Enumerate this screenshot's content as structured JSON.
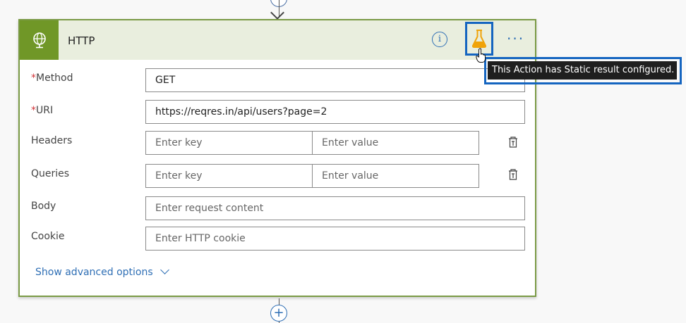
{
  "card": {
    "title": "HTTP",
    "icon": "globe-icon",
    "accent_color": "#709727",
    "header_bg": "#e9eede"
  },
  "fields": {
    "method": {
      "label": "Method",
      "required_mark": "*",
      "value": "GET"
    },
    "uri": {
      "label": "URI",
      "required_mark": "*",
      "value": "https://reqres.in/api/users?page=2"
    },
    "headers": {
      "label": "Headers",
      "key_placeholder": "Enter key",
      "value_placeholder": "Enter value"
    },
    "queries": {
      "label": "Queries",
      "key_placeholder": "Enter key",
      "value_placeholder": "Enter value"
    },
    "body": {
      "label": "Body",
      "placeholder": "Enter request content"
    },
    "cookie": {
      "label": "Cookie",
      "placeholder": "Enter HTTP cookie"
    }
  },
  "advanced_link": "Show advanced options",
  "tooltip": "This Action has Static result configured.",
  "icons": {
    "info": "info-icon",
    "static_result": "flask-icon",
    "more": "more-options-icon",
    "delete": "delete-row-icon",
    "add": "add-step-icon"
  },
  "colors": {
    "link": "#2f6fb5",
    "highlight_border": "#1565c0",
    "flask": "#f0a30a",
    "required": "#d13438"
  }
}
